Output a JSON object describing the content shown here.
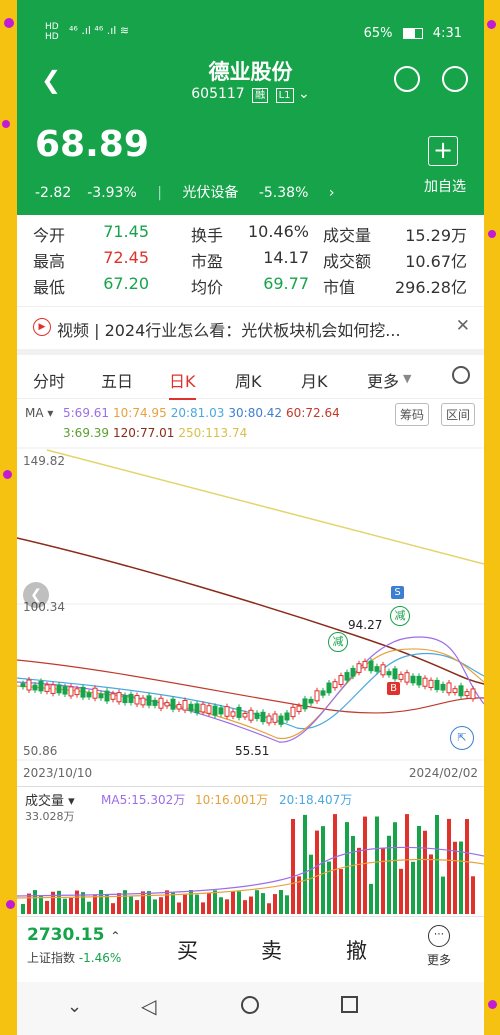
{
  "status": {
    "left_top": "HD",
    "left_bottom": "HD",
    "signal": "⁴⁶ .ıl ⁴⁶ .ıl ≋",
    "battery_pct": "65%",
    "time": "4:31"
  },
  "header": {
    "title": "德业股份",
    "code": "605117",
    "tag1": "融",
    "tag2": "L1"
  },
  "quote": {
    "price": "68.89",
    "change": "-2.82",
    "change_pct": "-3.93%",
    "sector": "光伏设备",
    "sector_pct": "-5.38%",
    "add_label": "加自选"
  },
  "stats": [
    [
      {
        "k": "今开",
        "v": "71.45",
        "c": "grn"
      },
      {
        "k": "换手",
        "v": "10.46%",
        "c": ""
      },
      {
        "k": "成交量",
        "v": "15.29万",
        "c": ""
      }
    ],
    [
      {
        "k": "最高",
        "v": "72.45",
        "c": "red"
      },
      {
        "k": "市盈",
        "v": "14.17",
        "c": ""
      },
      {
        "k": "成交额",
        "v": "10.67亿",
        "c": ""
      }
    ],
    [
      {
        "k": "最低",
        "v": "67.20",
        "c": "grn"
      },
      {
        "k": "均价",
        "v": "69.77",
        "c": "grn"
      },
      {
        "k": "市值",
        "v": "296.28亿",
        "c": ""
      }
    ]
  ],
  "news": {
    "text": "视频 | 2024行业怎么看：光伏板块机会如何挖..."
  },
  "tabs": [
    "分时",
    "五日",
    "日K",
    "周K",
    "月K",
    "更多"
  ],
  "ma": {
    "label": "MA",
    "line1": [
      {
        "t": "5:69.61",
        "c": "#9b6ee8"
      },
      {
        "t": "10:74.95",
        "c": "#e6a23c"
      },
      {
        "t": "20:81.03",
        "c": "#4aa8e0"
      },
      {
        "t": "30:80.42",
        "c": "#3c7fd1"
      },
      {
        "t": "60:72.64",
        "c": "#c0392b"
      }
    ],
    "line2": [
      {
        "t": "3:69.39",
        "c": "#5aa02c"
      },
      {
        "t": "120:77.01",
        "c": "#8b2a1a"
      },
      {
        "t": "250:113.74",
        "c": "#d6c24a"
      }
    ],
    "btn1": "筹码",
    "btn2": "区间"
  },
  "chart": {
    "y_top": "149.82",
    "y_mid": "100.34",
    "y_bot": "50.86",
    "date_left": "2023/10/10",
    "date_right": "2024/02/02",
    "low_label": "55.51",
    "high_label": "94.27",
    "badge_s": "S",
    "badge_b": "B",
    "reduce": "减"
  },
  "vol": {
    "label": "成交量",
    "ma5": "MA5:15.302万",
    "ma10": "10:16.001万",
    "ma20": "20:18.407万",
    "max": "33.028万"
  },
  "index": {
    "value": "2730.15",
    "name": "上证指数",
    "pct": "-1.46%"
  },
  "actions": {
    "buy": "买",
    "sell": "卖",
    "cancel": "撤",
    "more": "更多"
  },
  "colors": {
    "up": "#e0322c",
    "down": "#17a34a",
    "brand": "#17a34a"
  }
}
